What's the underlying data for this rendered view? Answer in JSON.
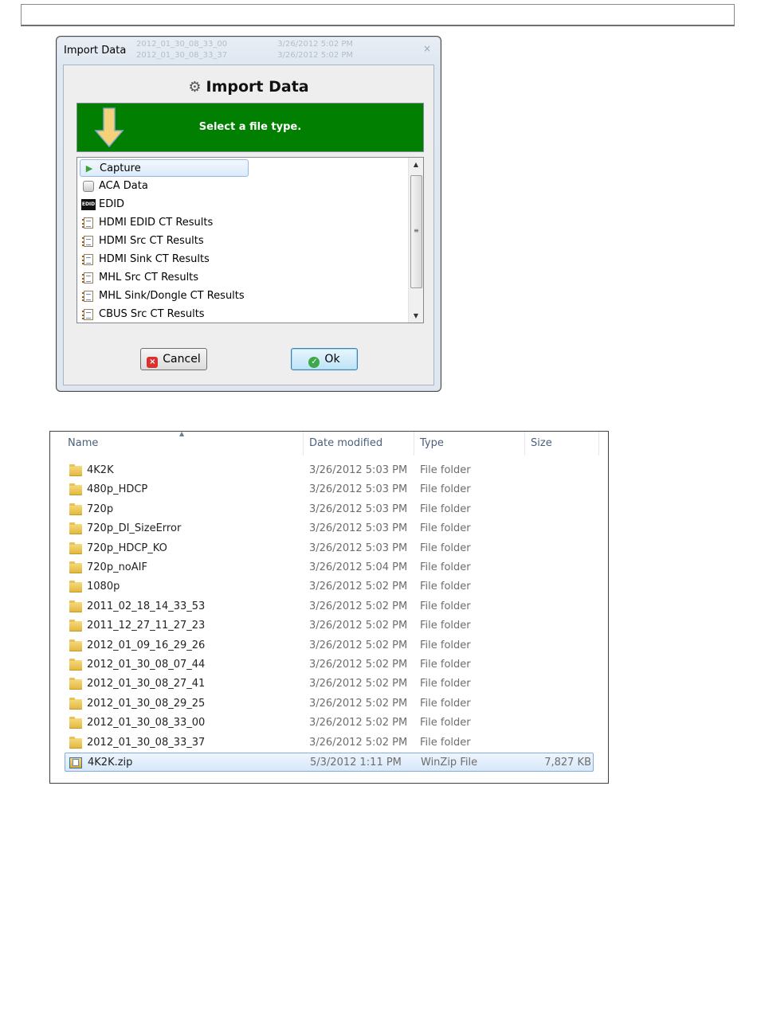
{
  "dialog": {
    "title": "Import Data",
    "close_glyph": "×",
    "background_rows": [
      {
        "name": "2012_01_30_08_33_00",
        "date": "3/26/2012 5:02 PM"
      },
      {
        "name": "2012_01_30_08_33_37",
        "date": "3/26/2012 5:02 PM"
      }
    ],
    "heading": "Import Data",
    "heading_icon": "import-wizard-icon",
    "banner_text": "Select a file type.",
    "banner_color": "#007f00",
    "file_types": [
      {
        "label": "Capture",
        "icon": "play-icon",
        "selected": true
      },
      {
        "label": "ACA Data",
        "icon": "disk-icon"
      },
      {
        "label": "EDID",
        "icon": "edid-icon",
        "icon_text": "EDID"
      },
      {
        "label": "HDMI EDID CT Results",
        "icon": "document-icon"
      },
      {
        "label": "HDMI Src CT Results",
        "icon": "document-icon"
      },
      {
        "label": "HDMI Sink CT Results",
        "icon": "document-icon"
      },
      {
        "label": "MHL Src CT Results",
        "icon": "document-icon"
      },
      {
        "label": "MHL Sink/Dongle CT Results",
        "icon": "document-icon"
      },
      {
        "label": "CBUS Src CT Results",
        "icon": "document-icon"
      }
    ],
    "cancel_label": "Cancel",
    "ok_label": "Ok"
  },
  "explorer": {
    "columns": {
      "name": "Name",
      "date": "Date modified",
      "type": "Type",
      "size": "Size"
    },
    "rows": [
      {
        "name": "4K2K",
        "date": "3/26/2012 5:03 PM",
        "type": "File folder",
        "size": "",
        "icon": "folder-icon"
      },
      {
        "name": "480p_HDCP",
        "date": "3/26/2012 5:03 PM",
        "type": "File folder",
        "size": "",
        "icon": "folder-icon"
      },
      {
        "name": "720p",
        "date": "3/26/2012 5:03 PM",
        "type": "File folder",
        "size": "",
        "icon": "folder-icon"
      },
      {
        "name": "720p_DI_SizeError",
        "date": "3/26/2012 5:03 PM",
        "type": "File folder",
        "size": "",
        "icon": "folder-icon"
      },
      {
        "name": "720p_HDCP_KO",
        "date": "3/26/2012 5:03 PM",
        "type": "File folder",
        "size": "",
        "icon": "folder-icon"
      },
      {
        "name": "720p_noAIF",
        "date": "3/26/2012 5:04 PM",
        "type": "File folder",
        "size": "",
        "icon": "folder-icon"
      },
      {
        "name": "1080p",
        "date": "3/26/2012 5:02 PM",
        "type": "File folder",
        "size": "",
        "icon": "folder-icon"
      },
      {
        "name": "2011_02_18_14_33_53",
        "date": "3/26/2012 5:02 PM",
        "type": "File folder",
        "size": "",
        "icon": "folder-icon"
      },
      {
        "name": "2011_12_27_11_27_23",
        "date": "3/26/2012 5:02 PM",
        "type": "File folder",
        "size": "",
        "icon": "folder-icon"
      },
      {
        "name": "2012_01_09_16_29_26",
        "date": "3/26/2012 5:02 PM",
        "type": "File folder",
        "size": "",
        "icon": "folder-icon"
      },
      {
        "name": "2012_01_30_08_07_44",
        "date": "3/26/2012 5:02 PM",
        "type": "File folder",
        "size": "",
        "icon": "folder-icon"
      },
      {
        "name": "2012_01_30_08_27_41",
        "date": "3/26/2012 5:02 PM",
        "type": "File folder",
        "size": "",
        "icon": "folder-icon"
      },
      {
        "name": "2012_01_30_08_29_25",
        "date": "3/26/2012 5:02 PM",
        "type": "File folder",
        "size": "",
        "icon": "folder-icon"
      },
      {
        "name": "2012_01_30_08_33_00",
        "date": "3/26/2012 5:02 PM",
        "type": "File folder",
        "size": "",
        "icon": "folder-icon"
      },
      {
        "name": "2012_01_30_08_33_37",
        "date": "3/26/2012 5:02 PM",
        "type": "File folder",
        "size": "",
        "icon": "folder-icon"
      },
      {
        "name": "4K2K.zip",
        "date": "5/3/2012 1:11 PM",
        "type": "WinZip File",
        "size": "7,827 KB",
        "icon": "zip-file-icon",
        "selected": true
      }
    ]
  }
}
